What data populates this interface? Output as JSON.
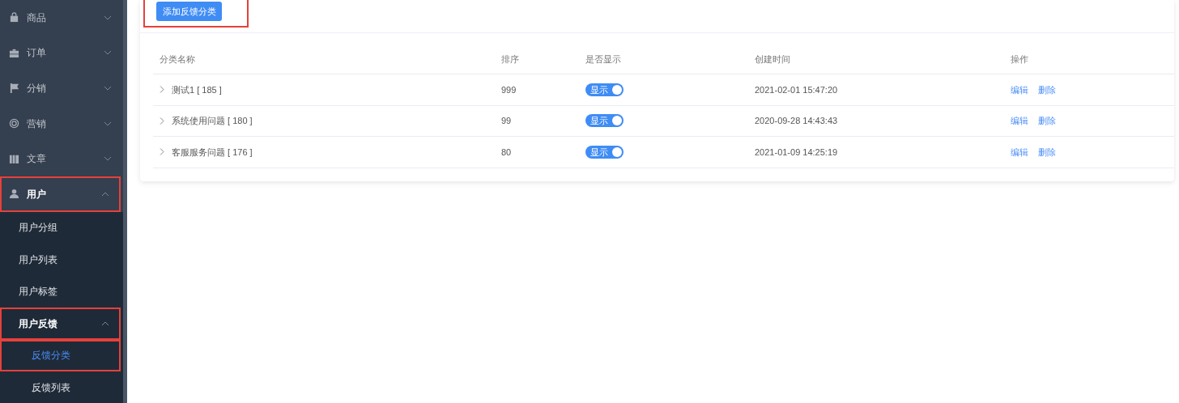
{
  "sidebar": {
    "items": [
      {
        "label": "商品",
        "expanded": false,
        "highlighted": false
      },
      {
        "label": "订单",
        "expanded": false,
        "highlighted": false
      },
      {
        "label": "分销",
        "expanded": false,
        "highlighted": false
      },
      {
        "label": "营销",
        "expanded": false,
        "highlighted": false
      },
      {
        "label": "文章",
        "expanded": false,
        "highlighted": false
      },
      {
        "label": "用户",
        "expanded": true,
        "highlighted": true,
        "children": [
          {
            "label": "用户分组",
            "highlighted": false
          },
          {
            "label": "用户列表",
            "highlighted": false
          },
          {
            "label": "用户标签",
            "highlighted": false
          },
          {
            "label": "用户反馈",
            "expanded": true,
            "highlighted": true,
            "children": [
              {
                "label": "反馈分类",
                "selected": true,
                "highlighted": true
              },
              {
                "label": "反馈列表",
                "selected": false,
                "highlighted": false
              }
            ]
          }
        ]
      }
    ]
  },
  "toolbar": {
    "add_button": {
      "label": "添加反馈分类",
      "highlighted": true
    }
  },
  "table": {
    "columns": [
      "分类名称",
      "排序",
      "是否显示",
      "创建时间",
      "操作"
    ],
    "rows": [
      {
        "name": "测试1 [ 185 ]",
        "expanded": false,
        "sort": "999",
        "visible": {
          "label": "显示",
          "on": true
        },
        "created": "2021-02-01 15:47:20",
        "actions": [
          "编辑",
          "删除"
        ]
      },
      {
        "name": "系统使用问题 [ 180 ]",
        "expanded": false,
        "sort": "99",
        "visible": {
          "label": "显示",
          "on": true
        },
        "created": "2020-09-28 14:43:43",
        "actions": [
          "编辑",
          "删除"
        ]
      },
      {
        "name": "客服服务问题 [ 176 ]",
        "expanded": false,
        "sort": "80",
        "visible": {
          "label": "显示",
          "on": true
        },
        "created": "2021-01-09 14:25:19",
        "actions": [
          "编辑",
          "删除"
        ]
      }
    ]
  }
}
